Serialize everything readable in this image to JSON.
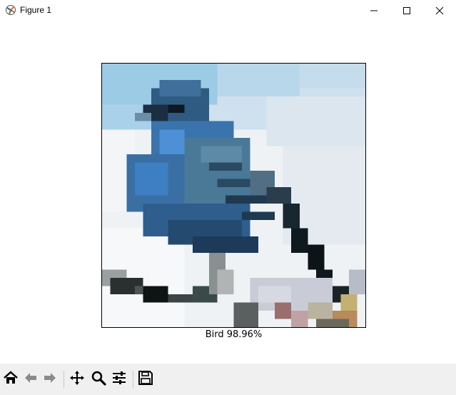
{
  "window": {
    "title": "Figure 1"
  },
  "titlebar_buttons": {
    "minimize_icon": "minimize-icon",
    "maximize_icon": "maximize-icon",
    "close_icon": "close-icon"
  },
  "figure": {
    "xlabel": "Bird 98.96%",
    "image_subject": "bird-image"
  },
  "toolbar": {
    "buttons": [
      {
        "icon": "home-icon"
      },
      {
        "icon": "back-arrow-icon"
      },
      {
        "icon": "forward-arrow-icon"
      },
      {
        "icon": "pan-icon"
      },
      {
        "icon": "zoom-icon"
      },
      {
        "icon": "configure-subplots-icon"
      },
      {
        "icon": "save-icon"
      }
    ]
  },
  "colors": {
    "toolbar_bg": "#f0f0f0",
    "sky_light": "#dce8f2",
    "sky_blue": "#a8cde6",
    "bird_blue": "#3a78b8",
    "bird_dark": "#1a3550",
    "branch_dark": "#1e2a2e"
  }
}
